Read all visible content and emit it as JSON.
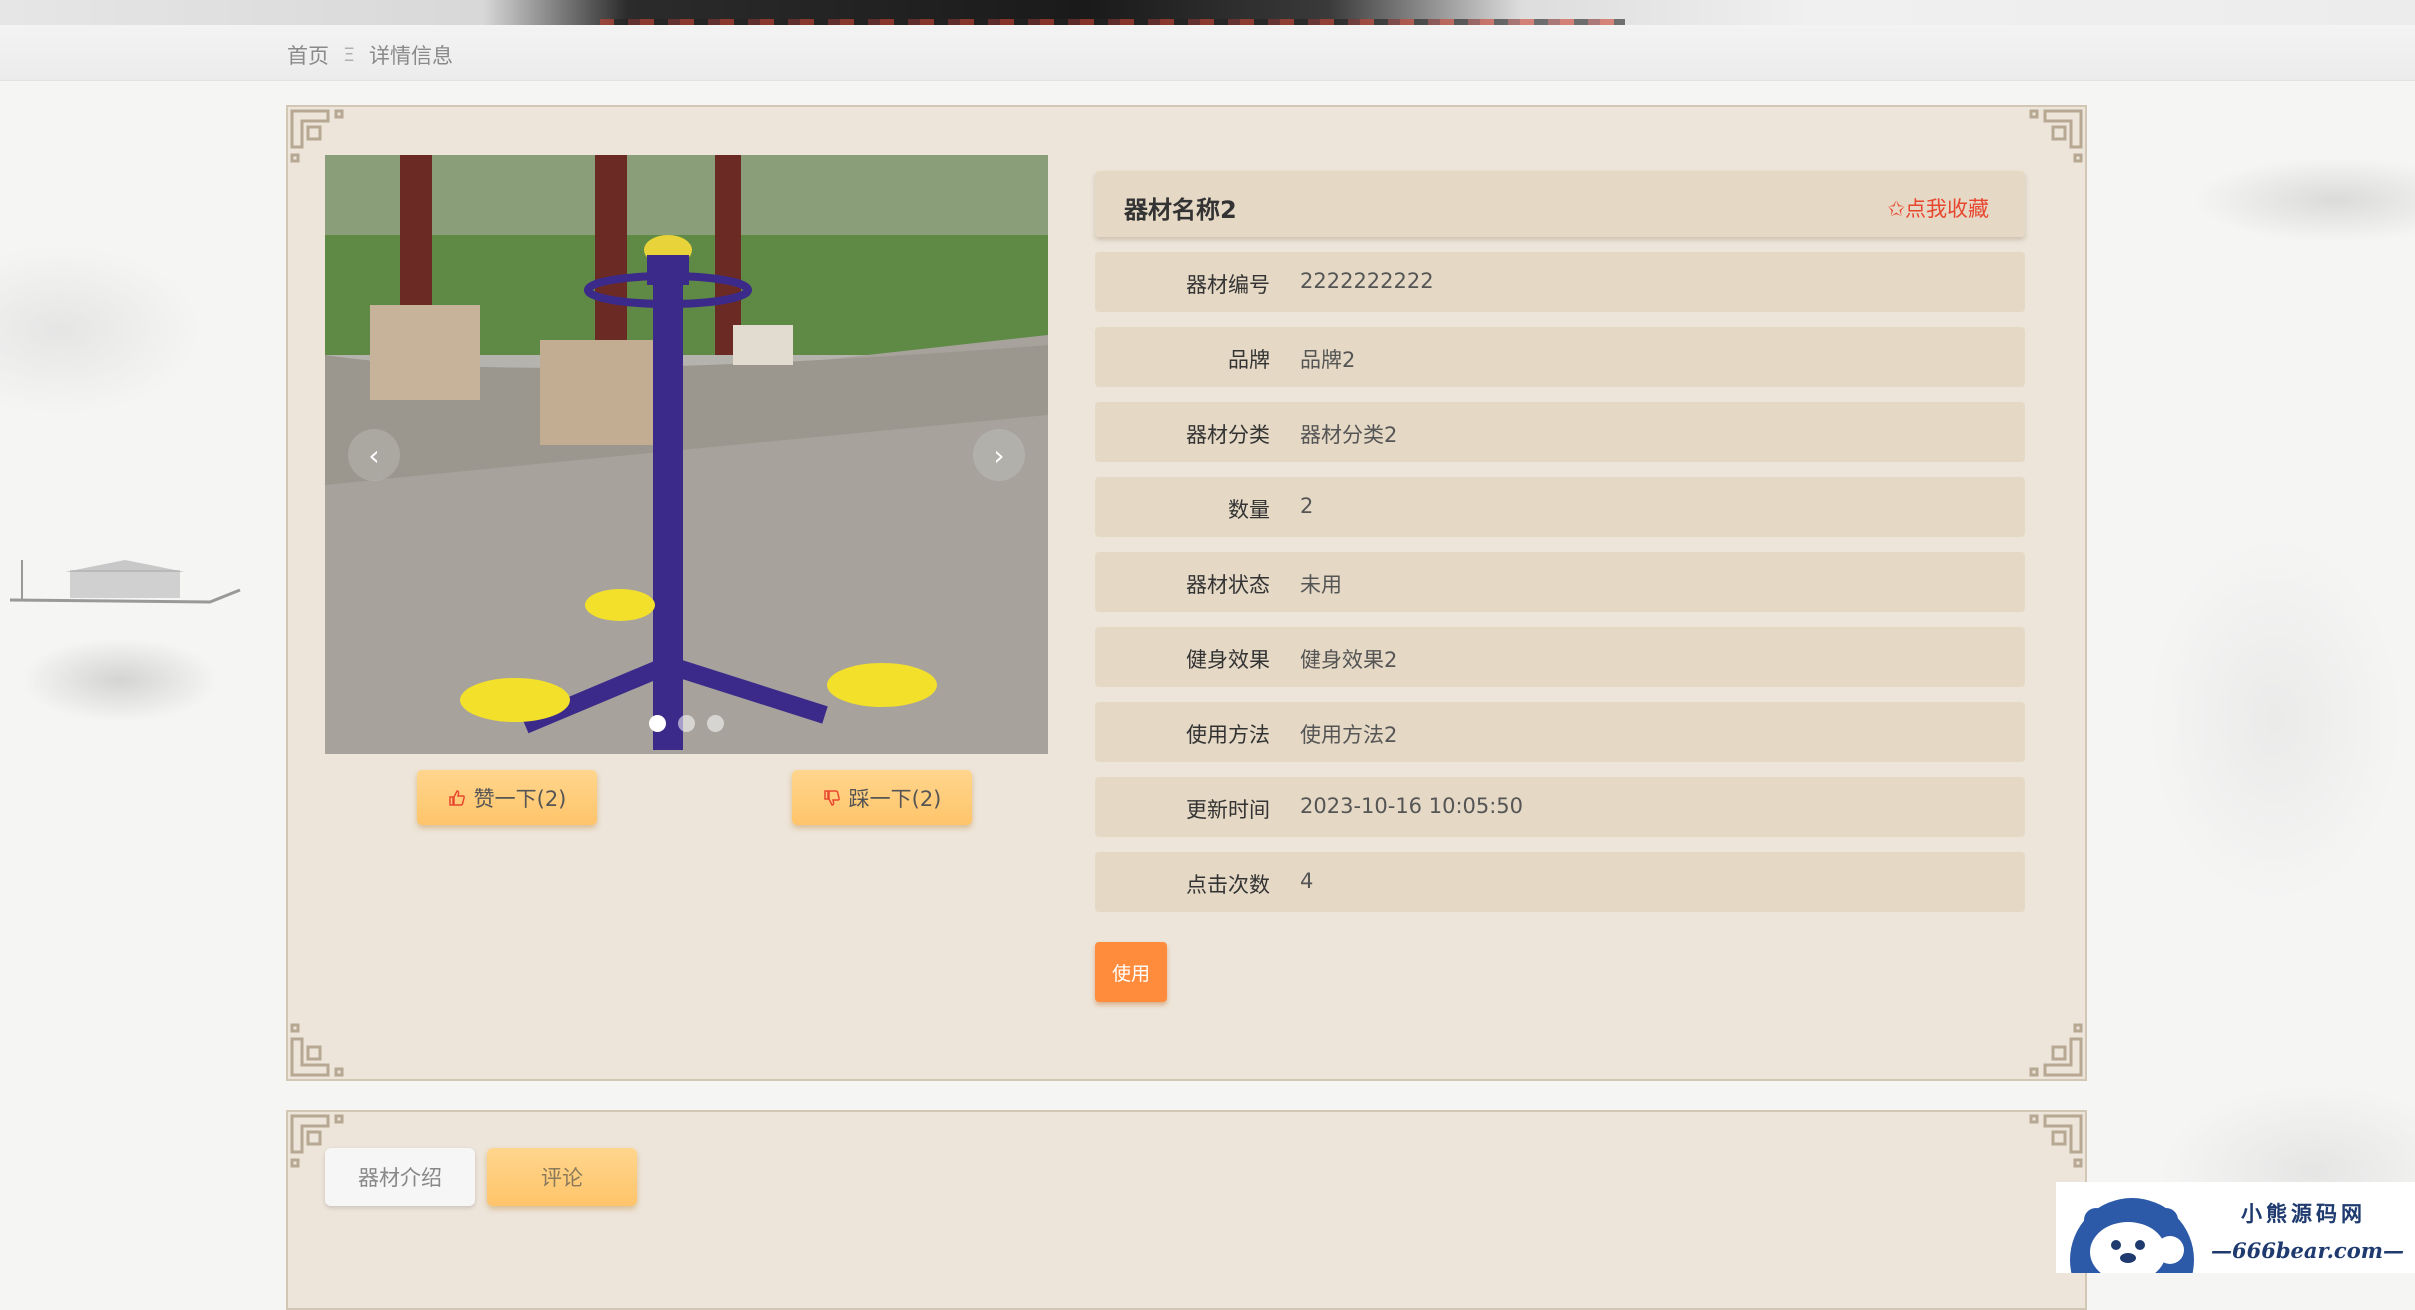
{
  "breadcrumb": {
    "home": "首页",
    "separator": "Ξ",
    "current": "详情信息"
  },
  "detail": {
    "name": "器材名称2",
    "favorite_label": "✩点我收藏",
    "fields": [
      {
        "label": "器材编号",
        "value": "2222222222"
      },
      {
        "label": "品牌",
        "value": "品牌2"
      },
      {
        "label": "器材分类",
        "value": "器材分类2"
      },
      {
        "label": "数量",
        "value": "2"
      },
      {
        "label": "器材状态",
        "value": "未用"
      },
      {
        "label": "健身效果",
        "value": "健身效果2"
      },
      {
        "label": "使用方法",
        "value": "使用方法2"
      },
      {
        "label": "更新时间",
        "value": "2023-10-16 10:05:50"
      },
      {
        "label": "点击次数",
        "value": "4"
      }
    ],
    "use_button": "使用"
  },
  "carousel": {
    "prev": "‹",
    "next": "›",
    "slide_count": 3,
    "active_slide": 1
  },
  "votes": {
    "like_label": "赞一下(2)",
    "dislike_label": "踩一下(2)"
  },
  "tabs": {
    "intro": "器材介绍",
    "comment": "评论"
  },
  "watermark": {
    "cn": "小熊源码网",
    "en": "—666bear.com—"
  },
  "colors": {
    "panel_bg": "#ede5da",
    "row_bg": "#e5d9c6",
    "accent_orange": "#fe8c3c",
    "button_gold": "#ffc46a",
    "favorite_red": "#e8472f"
  }
}
